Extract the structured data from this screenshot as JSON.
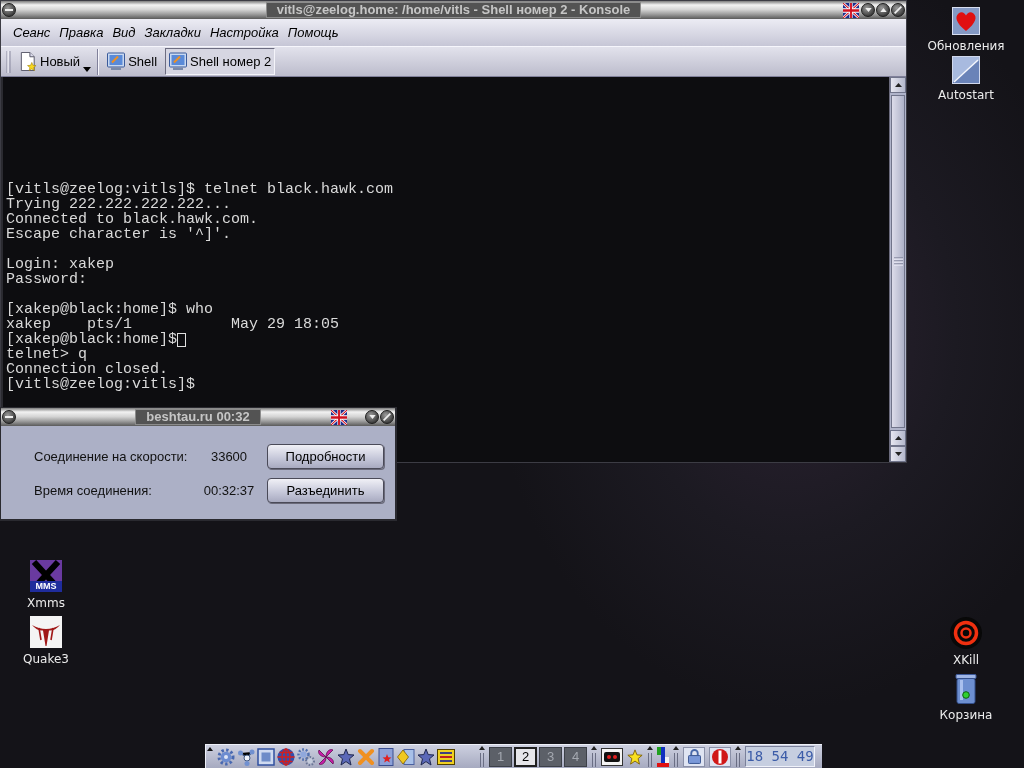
{
  "konsole_window": {
    "title": "vitls@zeelog.home: /home/vitls - Shell номер 2 - Konsole",
    "menu": [
      "Сеанс",
      "Правка",
      "Вид",
      "Закладки",
      "Настройка",
      "Помощь"
    ],
    "toolbar": {
      "new_button": "Новый",
      "sessions": [
        {
          "label": "Shell",
          "selected": false
        },
        {
          "label": "Shell номер 2",
          "selected": true
        }
      ]
    },
    "terminal": {
      "blocks": [
        [
          {
            "text": "[vitls@zeelog:vitls]$ telnet black.hawk.com",
            "cursor": false
          },
          {
            "text": "Trying 222.222.222.222...",
            "cursor": false
          },
          {
            "text": "Connected to black.hawk.com.",
            "cursor": false
          },
          {
            "text": "Escape character is '^]'.",
            "cursor": false
          }
        ],
        [
          {
            "text": "Login: xakep",
            "cursor": false
          },
          {
            "text": "Password:",
            "cursor": false
          }
        ],
        [
          {
            "text": "[xakep@black:home]$ who",
            "cursor": false
          },
          {
            "text": "xakep    pts/1           May 29 18:05",
            "cursor": false
          },
          {
            "text": "[xakep@black:home]$",
            "cursor": true
          },
          {
            "text": "telnet> q",
            "cursor": false
          },
          {
            "text": "Connection closed.",
            "cursor": false
          },
          {
            "text": "[vitls@zeelog:vitls]$",
            "cursor": false
          }
        ]
      ]
    }
  },
  "dialog_window": {
    "title": "beshtau.ru 00:32",
    "rows": [
      {
        "label": "Соединение на скорости:",
        "value": "33600",
        "button": "Подробности"
      },
      {
        "label": "Время соединения:",
        "value": "00:32:37",
        "button": "Разъединить"
      }
    ]
  },
  "desktop_icons": {
    "top_right": [
      {
        "label": "Обновления",
        "kind": "heart"
      },
      {
        "label": "Autostart",
        "kind": "folder"
      }
    ],
    "left": [
      {
        "label": "Xmms",
        "kind": "xmms",
        "icon_text": "MMS"
      },
      {
        "label": "Quake3",
        "kind": "quake"
      }
    ],
    "bottom_right": [
      {
        "label": "XKill",
        "kind": "target"
      },
      {
        "label": "Корзина",
        "kind": "trash"
      }
    ]
  },
  "taskbar": {
    "pager": [
      {
        "label": "1",
        "selected": false
      },
      {
        "label": "2",
        "selected": true
      },
      {
        "label": "3",
        "selected": false
      },
      {
        "label": "4",
        "selected": false
      }
    ],
    "clock": "18 54 49"
  }
}
